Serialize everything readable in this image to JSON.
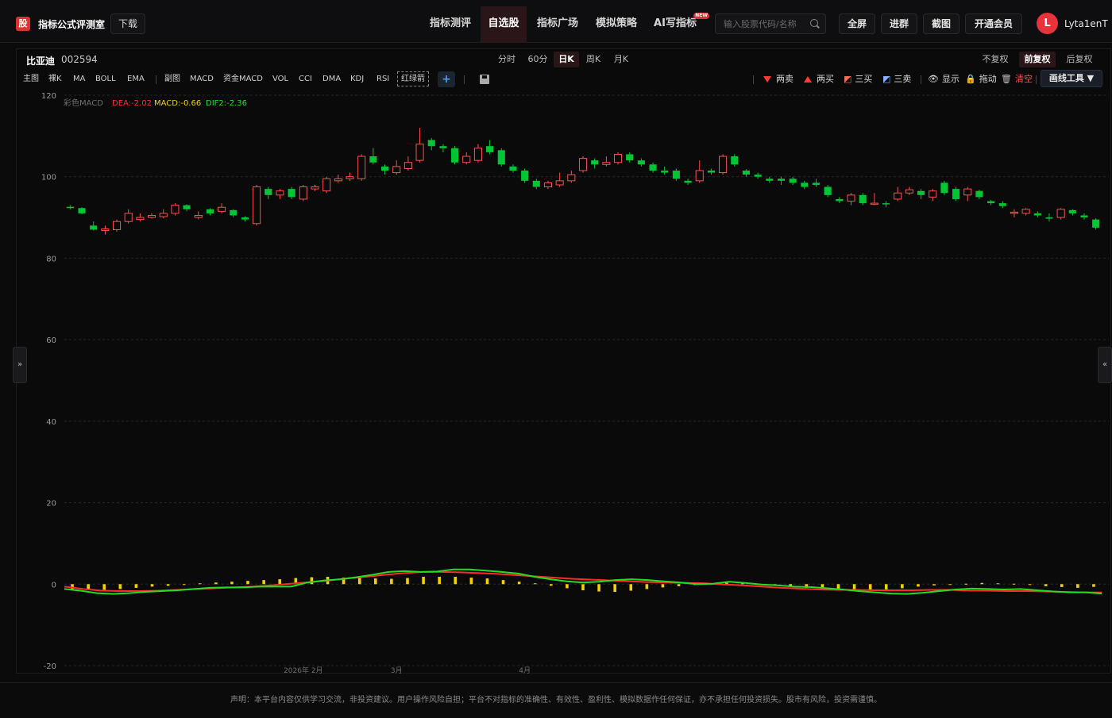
{
  "app": {
    "logo_glyph": "股",
    "name": "指标公式评测室",
    "download_label": "下载"
  },
  "nav": [
    {
      "label": "指标测评",
      "active": false
    },
    {
      "label": "自选股",
      "active": true
    },
    {
      "label": "指标广场",
      "active": false
    },
    {
      "label": "模拟策略",
      "active": false
    },
    {
      "label": "AI写指标",
      "active": false,
      "badge": "NEW"
    }
  ],
  "search": {
    "placeholder": "输入股票代码/名称"
  },
  "top_buttons": [
    "全屏",
    "进群",
    "截图",
    "开通会员"
  ],
  "user": {
    "avatar_letter": "L",
    "name": "Lyta1enT"
  },
  "stock": {
    "name": "比亚迪",
    "code": "002594"
  },
  "periods": [
    {
      "label": "分时",
      "active": false
    },
    {
      "label": "60分",
      "active": false
    },
    {
      "label": "日K",
      "active": true
    },
    {
      "label": "周K",
      "active": false
    },
    {
      "label": "月K",
      "active": false
    }
  ],
  "adjust": [
    {
      "label": "不复权",
      "active": false
    },
    {
      "label": "前复权",
      "active": true
    },
    {
      "label": "后复权",
      "active": false
    }
  ],
  "left_tools": [
    "主图",
    "裸K",
    "MA",
    "BOLL",
    "EMA",
    "副图",
    "MACD",
    "资金MACD",
    "VOL",
    "CCI",
    "DMA",
    "KDJ",
    "RSI"
  ],
  "red_green_label": "红绿箭",
  "plus_label": "+",
  "right_tools": {
    "sell2": "两卖",
    "buy2": "两买",
    "buy3": "三买",
    "sell3": "三卖",
    "show": "显示",
    "drag": "拖动",
    "clear": "清空",
    "draw": "画线工具 ▼"
  },
  "indicator_legend": {
    "name": "彩色MACD",
    "dea": "DEA:-2.02",
    "macd": "MACD:-0.66",
    "dif": "DIF2:-2.36"
  },
  "side_handles": {
    "left": "»",
    "right": "«"
  },
  "footer": "声明：本平台内容仅供学习交流，非投资建议。用户操作风险自担；平台不对指标的准确性、有效性、盈利性、模拟数据作任何保证，亦不承担任何投资损失。股市有风险，投资需谨慎。",
  "colors": {
    "up": "#ff4d4d",
    "down": "#00c535",
    "dea": "#ff2a2a",
    "dif": "#22dd22",
    "macd_bar": "#f5d000",
    "brand": "#e03030"
  },
  "chart_data": {
    "type": "candlestick",
    "y_ticks": [
      120,
      100,
      80,
      60,
      40,
      20,
      0,
      -20
    ],
    "ylim": [
      -20,
      120
    ],
    "x_labels": [
      {
        "label": "2026年 2月",
        "index": 20
      },
      {
        "label": "3月",
        "index": 28
      },
      {
        "label": "4月",
        "index": 39
      }
    ],
    "candles": [
      [
        92.6,
        92.3,
        93.0,
        92.0
      ],
      [
        92.3,
        91.0,
        92.5,
        90.8
      ],
      [
        88.0,
        87.0,
        89.0,
        86.8
      ],
      [
        86.8,
        87.2,
        88.0,
        85.8
      ],
      [
        87.0,
        89.0,
        89.5,
        86.5
      ],
      [
        89.0,
        91.0,
        92.0,
        88.5
      ],
      [
        89.5,
        90.0,
        91.0,
        89.0
      ],
      [
        90.0,
        90.5,
        91.0,
        89.7
      ],
      [
        90.2,
        91.0,
        92.0,
        89.8
      ],
      [
        91.0,
        93.0,
        93.5,
        90.5
      ],
      [
        93.0,
        92.0,
        93.2,
        91.5
      ],
      [
        90.0,
        90.5,
        91.5,
        89.5
      ],
      [
        92.0,
        91.0,
        92.3,
        90.5
      ],
      [
        91.5,
        92.5,
        93.5,
        91.0
      ],
      [
        91.8,
        90.5,
        92.0,
        90.0
      ],
      [
        90.0,
        89.5,
        90.3,
        89.0
      ],
      [
        88.5,
        97.5,
        98.0,
        88.0
      ],
      [
        97.0,
        95.5,
        97.5,
        94.5
      ],
      [
        95.5,
        96.5,
        97.0,
        94.5
      ],
      [
        97.0,
        95.0,
        97.5,
        94.5
      ],
      [
        94.5,
        97.5,
        98.0,
        94.0
      ],
      [
        97.0,
        97.5,
        98.0,
        96.5
      ],
      [
        96.5,
        99.5,
        100.0,
        96.0
      ],
      [
        99.0,
        99.5,
        100.5,
        98.5
      ],
      [
        99.5,
        100.0,
        101.0,
        99.0
      ],
      [
        99.5,
        105.0,
        105.5,
        99.0
      ],
      [
        105.0,
        103.5,
        107.0,
        103.0
      ],
      [
        102.5,
        101.5,
        103.0,
        100.5
      ],
      [
        101.0,
        102.5,
        104.0,
        100.5
      ],
      [
        102.0,
        103.5,
        105.0,
        101.5
      ],
      [
        104.0,
        108.0,
        112.0,
        103.5
      ],
      [
        109.0,
        107.5,
        109.5,
        106.5
      ],
      [
        107.5,
        107.0,
        108.0,
        106.0
      ],
      [
        107.0,
        103.5,
        107.5,
        103.0
      ],
      [
        103.5,
        105.0,
        106.0,
        103.0
      ],
      [
        104.0,
        107.0,
        108.0,
        103.5
      ],
      [
        107.5,
        106.0,
        109.0,
        105.5
      ],
      [
        106.5,
        103.0,
        107.0,
        102.5
      ],
      [
        102.5,
        101.5,
        103.0,
        101.0
      ],
      [
        101.5,
        99.0,
        102.0,
        98.5
      ],
      [
        99.0,
        97.5,
        99.5,
        97.0
      ],
      [
        97.5,
        98.5,
        99.0,
        97.0
      ],
      [
        98.0,
        99.0,
        101.0,
        97.5
      ],
      [
        99.0,
        100.5,
        101.5,
        98.5
      ],
      [
        101.5,
        104.5,
        105.0,
        101.0
      ],
      [
        104.0,
        103.0,
        104.5,
        102.0
      ],
      [
        103.0,
        103.5,
        105.0,
        102.5
      ],
      [
        103.5,
        105.5,
        106.0,
        103.0
      ],
      [
        105.5,
        104.0,
        106.0,
        103.5
      ],
      [
        104.0,
        103.0,
        104.5,
        102.5
      ],
      [
        103.0,
        101.5,
        103.5,
        101.0
      ],
      [
        101.5,
        101.0,
        102.5,
        100.5
      ],
      [
        101.5,
        99.5,
        102.0,
        99.0
      ],
      [
        99.0,
        98.5,
        99.5,
        98.0
      ],
      [
        99.0,
        101.5,
        104.0,
        98.5
      ],
      [
        101.5,
        101.0,
        102.0,
        100.5
      ],
      [
        101.0,
        105.0,
        105.5,
        100.5
      ],
      [
        105.0,
        103.0,
        105.5,
        102.5
      ],
      [
        101.5,
        100.5,
        101.8,
        100.0
      ],
      [
        100.5,
        100.0,
        101.0,
        99.5
      ],
      [
        99.5,
        99.0,
        100.0,
        98.5
      ],
      [
        99.5,
        99.0,
        100.0,
        98.0
      ],
      [
        99.5,
        98.5,
        100.0,
        98.0
      ],
      [
        98.5,
        97.5,
        99.0,
        97.0
      ],
      [
        98.5,
        98.0,
        99.5,
        97.5
      ],
      [
        97.5,
        95.5,
        98.0,
        95.0
      ],
      [
        94.5,
        94.0,
        95.0,
        93.5
      ],
      [
        94.0,
        95.5,
        96.0,
        93.0
      ],
      [
        95.5,
        93.5,
        96.0,
        93.0
      ],
      [
        93.5,
        93.5,
        96.0,
        93.0
      ],
      [
        93.5,
        93.3,
        94.0,
        92.5
      ],
      [
        94.5,
        96.0,
        97.5,
        94.0
      ],
      [
        96.0,
        96.8,
        97.5,
        95.5
      ],
      [
        96.5,
        95.5,
        97.0,
        94.5
      ],
      [
        95.0,
        96.5,
        97.0,
        94.0
      ],
      [
        98.5,
        96.0,
        99.0,
        95.5
      ],
      [
        97.0,
        94.5,
        97.5,
        94.0
      ],
      [
        95.5,
        97.0,
        97.5,
        94.0
      ],
      [
        96.5,
        95.0,
        96.8,
        94.5
      ],
      [
        94.0,
        93.5,
        94.3,
        93.0
      ],
      [
        93.5,
        92.8,
        94.0,
        92.3
      ],
      [
        91.0,
        91.3,
        92.0,
        90.0
      ],
      [
        91.0,
        92.0,
        92.3,
        90.5
      ],
      [
        91.0,
        90.5,
        91.5,
        90.0
      ],
      [
        90.0,
        89.8,
        91.0,
        89.0
      ],
      [
        90.0,
        92.0,
        92.3,
        89.5
      ],
      [
        91.8,
        91.0,
        92.0,
        90.5
      ],
      [
        90.5,
        90.0,
        91.0,
        89.5
      ],
      [
        89.5,
        87.5,
        89.8,
        87.0
      ]
    ],
    "dif": [
      -1.2,
      -1.6,
      -2.2,
      -2.4,
      -2.2,
      -1.9,
      -1.7,
      -1.5,
      -1.2,
      -0.9,
      -0.8,
      -0.8,
      -0.6,
      -0.6,
      -0.6,
      0.4,
      0.9,
      1.2,
      1.7,
      2.3,
      3.0,
      3.2,
      3.0,
      3.1,
      3.6,
      3.6,
      3.3,
      3.0,
      2.6,
      1.8,
      1.2,
      0.7,
      0.4,
      0.6,
      1.0,
      1.2,
      1.0,
      0.7,
      0.4,
      0.0,
      0.1,
      0.6,
      0.3,
      -0.1,
      -0.3,
      -0.6,
      -0.7,
      -1.0,
      -1.3,
      -1.7,
      -2.0,
      -2.3,
      -2.4,
      -2.1,
      -1.7,
      -1.3,
      -1.1,
      -1.2,
      -1.3,
      -1.2,
      -1.5,
      -1.8,
      -2.0,
      -2.0,
      -2.3
    ],
    "dea": [
      -0.6,
      -1.2,
      -1.6,
      -1.7,
      -1.7,
      -1.6,
      -1.4,
      -1.2,
      -1.0,
      -0.8,
      -0.6,
      -0.3,
      0.1,
      0.5,
      0.9,
      1.4,
      1.8,
      2.3,
      2.7,
      3.0,
      3.0,
      2.9,
      2.7,
      2.5,
      2.2,
      1.9,
      1.6,
      1.3,
      1.1,
      0.9,
      0.7,
      0.5,
      0.4,
      0.3,
      0.2,
      -0.1,
      -0.3,
      -0.6,
      -0.9,
      -1.1,
      -1.3,
      -1.4,
      -1.4,
      -1.5,
      -1.5,
      -1.5,
      -1.4,
      -1.4,
      -1.6,
      -1.6,
      -1.7,
      -1.7,
      -1.8,
      -1.9,
      -2.0,
      -2.02
    ],
    "macd_bars": [
      -1.2,
      -1.4,
      -1.4,
      -1.2,
      -0.9,
      -0.6,
      -0.4,
      -0.2,
      0.2,
      0.4,
      0.6,
      0.8,
      1.0,
      1.2,
      1.5,
      1.7,
      1.8,
      1.6,
      1.5,
      1.4,
      1.3,
      1.5,
      1.8,
      1.8,
      1.8,
      1.6,
      1.4,
      1.0,
      0.6,
      0.2,
      -0.4,
      -1.0,
      -1.5,
      -1.8,
      -1.9,
      -1.6,
      -1.2,
      -0.8,
      -0.5,
      -0.2,
      0.1,
      0.4,
      0.3,
      0.1,
      -0.3,
      -0.6,
      -0.9,
      -1.0,
      -1.2,
      -1.4,
      -1.5,
      -1.3,
      -1.0,
      -0.6,
      -0.3,
      -0.1,
      0.1,
      0.3,
      0.2,
      0.1,
      -0.2,
      -0.5,
      -0.7,
      -0.9,
      -0.66
    ]
  }
}
